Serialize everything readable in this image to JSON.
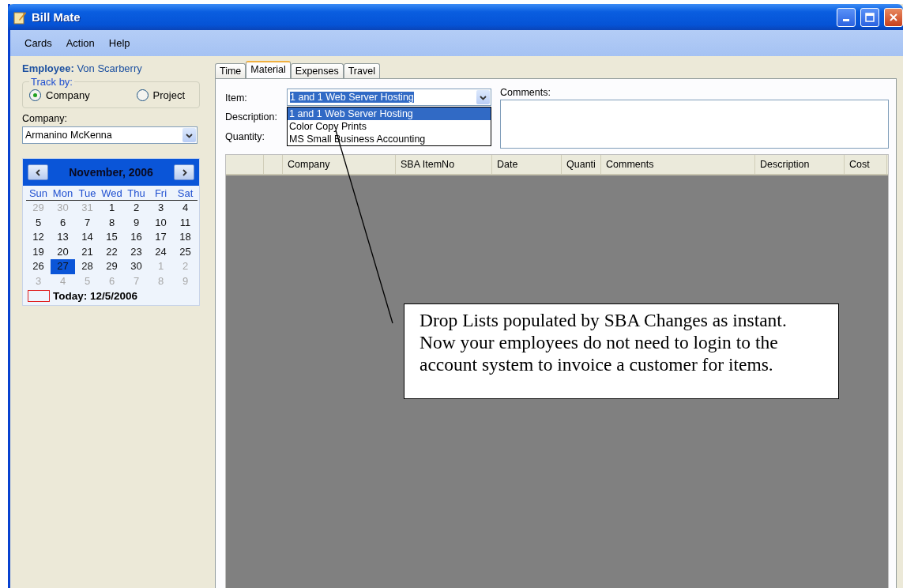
{
  "window": {
    "title": "Bill Mate"
  },
  "menu": [
    "Cards",
    "Action",
    "Help"
  ],
  "employee": {
    "label": "Employee:",
    "name": "Von Scarberry"
  },
  "track_by": {
    "label": "Track by:",
    "options": [
      {
        "label": "Company",
        "selected": true
      },
      {
        "label": "Project",
        "selected": false
      }
    ]
  },
  "company": {
    "label": "Company:",
    "value": "Armanino McKenna"
  },
  "calendar": {
    "month": "November, 2006",
    "weekdays": [
      "Sun",
      "Mon",
      "Tue",
      "Wed",
      "Thu",
      "Fri",
      "Sat"
    ],
    "weeks": [
      [
        {
          "day": "29",
          "muted": true,
          "selected": false
        },
        {
          "day": "30",
          "muted": true,
          "selected": false
        },
        {
          "day": "31",
          "muted": true,
          "selected": false
        },
        {
          "day": "1",
          "muted": false,
          "selected": false
        },
        {
          "day": "2",
          "muted": false,
          "selected": false
        },
        {
          "day": "3",
          "muted": false,
          "selected": false
        },
        {
          "day": "4",
          "muted": false,
          "selected": false
        }
      ],
      [
        {
          "day": "5",
          "muted": false,
          "selected": false
        },
        {
          "day": "6",
          "muted": false,
          "selected": false
        },
        {
          "day": "7",
          "muted": false,
          "selected": false
        },
        {
          "day": "8",
          "muted": false,
          "selected": false
        },
        {
          "day": "9",
          "muted": false,
          "selected": false
        },
        {
          "day": "10",
          "muted": false,
          "selected": false
        },
        {
          "day": "11",
          "muted": false,
          "selected": false
        }
      ],
      [
        {
          "day": "12",
          "muted": false,
          "selected": false
        },
        {
          "day": "13",
          "muted": false,
          "selected": false
        },
        {
          "day": "14",
          "muted": false,
          "selected": false
        },
        {
          "day": "15",
          "muted": false,
          "selected": false
        },
        {
          "day": "16",
          "muted": false,
          "selected": false
        },
        {
          "day": "17",
          "muted": false,
          "selected": false
        },
        {
          "day": "18",
          "muted": false,
          "selected": false
        }
      ],
      [
        {
          "day": "19",
          "muted": false,
          "selected": false
        },
        {
          "day": "20",
          "muted": false,
          "selected": false
        },
        {
          "day": "21",
          "muted": false,
          "selected": false
        },
        {
          "day": "22",
          "muted": false,
          "selected": false
        },
        {
          "day": "23",
          "muted": false,
          "selected": false
        },
        {
          "day": "24",
          "muted": false,
          "selected": false
        },
        {
          "day": "25",
          "muted": false,
          "selected": false
        }
      ],
      [
        {
          "day": "26",
          "muted": false,
          "selected": false
        },
        {
          "day": "27",
          "muted": false,
          "selected": true
        },
        {
          "day": "28",
          "muted": false,
          "selected": false
        },
        {
          "day": "29",
          "muted": false,
          "selected": false
        },
        {
          "day": "30",
          "muted": false,
          "selected": false
        },
        {
          "day": "1",
          "muted": true,
          "selected": false
        },
        {
          "day": "2",
          "muted": true,
          "selected": false
        }
      ],
      [
        {
          "day": "3",
          "muted": true,
          "selected": false
        },
        {
          "day": "4",
          "muted": true,
          "selected": false
        },
        {
          "day": "5",
          "muted": true,
          "selected": false
        },
        {
          "day": "6",
          "muted": true,
          "selected": false
        },
        {
          "day": "7",
          "muted": true,
          "selected": false
        },
        {
          "day": "8",
          "muted": true,
          "selected": false
        },
        {
          "day": "9",
          "muted": true,
          "selected": false
        }
      ]
    ],
    "today": "Today: 12/5/2006"
  },
  "tabs": [
    {
      "label": "Time",
      "selected": false
    },
    {
      "label": "Material",
      "selected": true
    },
    {
      "label": "Expenses",
      "selected": false
    },
    {
      "label": "Travel",
      "selected": false
    }
  ],
  "form": {
    "item_label": "Item:",
    "item_value": "1 and 1 Web Server Hosting",
    "description_label": "Description:",
    "quantity_label": "Quantity:",
    "comments_label": "Comments:"
  },
  "dropdown": {
    "options": [
      {
        "label": "1 and 1 Web Server Hosting",
        "selected": true
      },
      {
        "label": "Color Copy Prints",
        "selected": false
      },
      {
        "label": "MS Small Business Accounting",
        "selected": false
      }
    ]
  },
  "grid": {
    "columns": [
      "Company",
      "SBA ItemNo",
      "Date",
      "Quanti",
      "Comments",
      "Description",
      "Cost"
    ]
  },
  "callout": {
    "text": "Drop Lists populated by SBA Changes as instant. Now your employees do not need to login to the account system to invoice a customer for items."
  }
}
